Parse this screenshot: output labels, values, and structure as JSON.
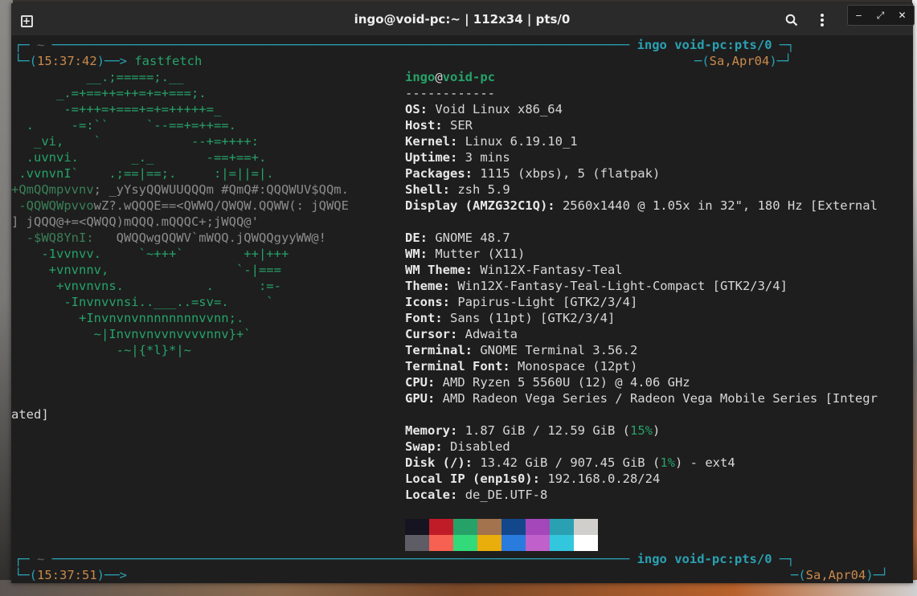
{
  "window": {
    "title": "ingo@void-pc:~ | 112x34 | pts/0",
    "icons": {
      "new_tab": "new-tab-icon",
      "search": "search-icon",
      "menu": "kebab-menu-icon",
      "minimize": "minimize-icon",
      "maximize": "maximize-icon",
      "close": "close-icon"
    }
  },
  "prompt1": {
    "dir": "~",
    "right": "ingo void-pc:pts/0",
    "time": "15:37:42",
    "command": "fastfetch",
    "date": "Sa,Apr04"
  },
  "prompt2": {
    "dir": "~",
    "right": "ingo void-pc:pts/0",
    "time": "15:37:51",
    "date": "Sa,Apr04"
  },
  "logo_lines": [
    {
      "text": "          __.;=====;.__",
      "cls": "g1"
    },
    {
      "text": "      _.=+==++=++=+=+===;.",
      "cls": "g1"
    },
    {
      "text": "       -=+++=+===+=+=+++++=_",
      "cls": "g1"
    },
    {
      "text": "  .     -=:``     `--==+=++==.",
      "cls": "g1"
    },
    {
      "text": "   _vi,    `            --+=++++:",
      "cls": "g1"
    },
    {
      "text": "  .uvnvi.       _._       -==+==+.",
      "cls": "g1"
    },
    {
      "text": " .vvnvnI`    .;==|==;.     :|=||=|.",
      "cls": "g1"
    },
    {
      "text": "+QmQQmpvvnv; _yYsyQQWUUQQQm #QmQ#:QQQWUV$QQm.",
      "cls": "mix1"
    },
    {
      "text": " -QQWQWpvvowZ?.wQQQE==<QWWQ/QWQW.QQWW(: jQWQE",
      "cls": "mix2"
    },
    {
      "text": "  -$QQQQmmU'  jQQQ@+=<QWQQ)mQQQ.mQQQC+;jWQQ@'",
      "cls": "mix3"
    },
    {
      "text": "  -$WQ8YnI:   QWQQwgQQWV`mWQQ.jQWQQgyyWW@!",
      "cls": "mix4"
    },
    {
      "text": "    -1vvnvv.     `~+++`        ++|+++",
      "cls": "g1"
    },
    {
      "text": "     +vnvnnv,                 `-|===",
      "cls": "g1"
    },
    {
      "text": "      +vnvnvns.           .      :=-",
      "cls": "g1"
    },
    {
      "text": "       -Invnvvnsi..___..=sv=.     `",
      "cls": "g1"
    },
    {
      "text": "         +Invnvnvnnnnnnnnvvnn;.",
      "cls": "g1"
    },
    {
      "text": "           ~|Invnvnvvnvvvvnnv}+`",
      "cls": "g1"
    },
    {
      "text": "              -~|{*l}*|~",
      "cls": "g1"
    }
  ],
  "wrap_line": "] jQQQ@+=<QWQQ)mQQQ.mQQQC+;jWQQ@'",
  "ated_line": "ated]",
  "info": {
    "user": "ingo",
    "at": "@",
    "host": "void-pc",
    "separator": "------------",
    "rows": [
      {
        "key": "OS",
        "value": "Void Linux x86_64"
      },
      {
        "key": "Host",
        "value": "SER"
      },
      {
        "key": "Kernel",
        "value": "Linux 6.19.10_1"
      },
      {
        "key": "Uptime",
        "value": "3 mins"
      },
      {
        "key": "Packages",
        "value": "1115 (xbps), 5 (flatpak)"
      },
      {
        "key": "Shell",
        "value": "zsh 5.9"
      },
      {
        "key": "Display (AMZG32C1Q)",
        "value": "2560x1440 @ 1.05x in 32\", 180 Hz [External"
      }
    ],
    "rows2": [
      {
        "key": "DE",
        "value": "GNOME 48.7"
      },
      {
        "key": "WM",
        "value": "Mutter (X11)"
      },
      {
        "key": "WM Theme",
        "value": "Win12X-Fantasy-Teal"
      },
      {
        "key": "Theme",
        "value": "Win12X-Fantasy-Teal-Light-Compact [GTK2/3/4]"
      },
      {
        "key": "Icons",
        "value": "Papirus-Light [GTK2/3/4]"
      },
      {
        "key": "Font",
        "value": "Sans (11pt) [GTK2/3/4]"
      },
      {
        "key": "Cursor",
        "value": "Adwaita"
      },
      {
        "key": "Terminal",
        "value": "GNOME Terminal 3.56.2"
      },
      {
        "key": "Terminal Font",
        "value": "Monospace (12pt)"
      },
      {
        "key": "CPU",
        "value": "AMD Ryzen 5 5560U (12) @ 4.06 GHz"
      },
      {
        "key": "GPU",
        "value": "AMD Radeon Vega Series / Radeon Vega Mobile Series [Integr"
      }
    ],
    "memory": {
      "key": "Memory",
      "value": "1.87 GiB / 12.59 GiB",
      "pct": "15%"
    },
    "swap": {
      "key": "Swap",
      "value": "Disabled"
    },
    "disk": {
      "key": "Disk (/)",
      "value": "13.42 GiB / 907.45 GiB",
      "pct": "1%",
      "suffix": "- ext4"
    },
    "localip": {
      "key": "Local IP (enp1s0)",
      "value": "192.168.0.28/24"
    },
    "locale": {
      "key": "Locale",
      "value": "de_DE.UTF-8"
    }
  },
  "palette": {
    "top": [
      "#171421",
      "#c01c28",
      "#26a269",
      "#a2734c",
      "#12488b",
      "#a347ba",
      "#2aa1b3",
      "#d0cfcc"
    ],
    "bottom": [
      "#5e5c64",
      "#f66151",
      "#33da7a",
      "#e9ad0c",
      "#2a7bde",
      "#c061cb",
      "#33c7de",
      "#ffffff"
    ]
  }
}
